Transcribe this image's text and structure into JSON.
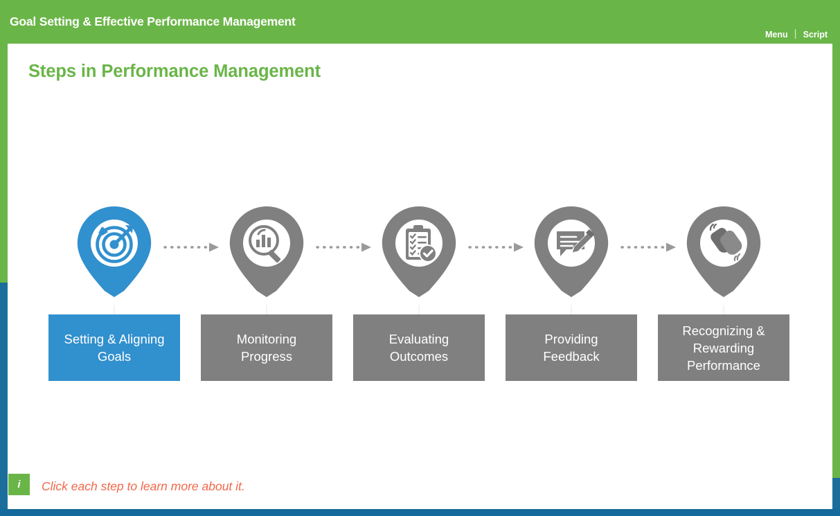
{
  "header": {
    "title": "Goal Setting & Effective Performance Management",
    "nav": {
      "menu_label": "Menu",
      "separator": "|",
      "script_label": "Script"
    },
    "bg_color": "#6ab548"
  },
  "slide": {
    "title": "Steps in Performance Management",
    "title_color": "#6ab548"
  },
  "steps": [
    {
      "label": "Setting & Aligning\nGoals",
      "label_line1": "Setting & Aligning",
      "label_line2": "Goals",
      "icon": "target-bullseye-arrow-icon",
      "active": true,
      "color": "#3190ce"
    },
    {
      "label": "Monitoring\nProgress",
      "label_line1": "Monitoring",
      "label_line2": "Progress",
      "icon": "magnifier-bar-chart-icon",
      "active": false,
      "color": "#808080"
    },
    {
      "label": "Evaluating\nOutcomes",
      "label_line1": "Evaluating",
      "label_line2": "Outcomes",
      "icon": "clipboard-checklist-check-icon",
      "active": false,
      "color": "#808080"
    },
    {
      "label": "Providing\nFeedback",
      "label_line1": "Providing",
      "label_line2": "Feedback",
      "icon": "speech-bubble-pencil-icon",
      "active": false,
      "color": "#808080"
    },
    {
      "label": "Recognizing &\nRewarding\nPerformance",
      "label_line1": "Recognizing &",
      "label_line2": "Rewarding",
      "label_line3": "Performance",
      "icon": "clapping-hands-icon",
      "active": false,
      "color": "#808080"
    }
  ],
  "note": {
    "icon": "i",
    "icon_name": "info-icon",
    "text": "Click each step to learn more about it.",
    "text_color": "#f2674a",
    "icon_bg": "#6ab548"
  },
  "frame": {
    "green": "#6ab548",
    "blue": "#136a9b"
  }
}
